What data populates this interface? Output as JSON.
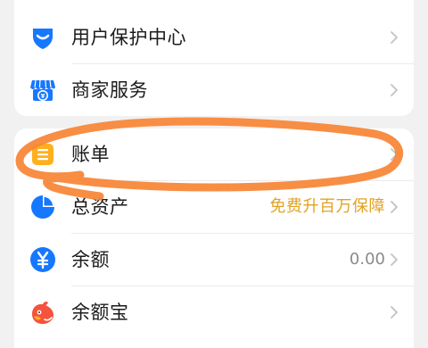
{
  "menu_top": [
    {
      "label": "用户保护中心",
      "icon": "shield-icon"
    },
    {
      "label": "商家服务",
      "icon": "store-icon"
    }
  ],
  "menu_bottom": [
    {
      "label": "账单",
      "icon": "bill-icon"
    },
    {
      "label": "总资产",
      "icon": "assets-pie-icon",
      "value": "免费升百万保障"
    },
    {
      "label": "余额",
      "icon": "yuan-coin-icon",
      "value": "0.00"
    },
    {
      "label": "余额宝",
      "icon": "yuebao-icon"
    }
  ],
  "colors": {
    "shield_blue": "#1677ff",
    "bill_yellow": "#ffb01f",
    "promo_gold": "#e3a223",
    "annotation_orange": "#f7883a"
  }
}
